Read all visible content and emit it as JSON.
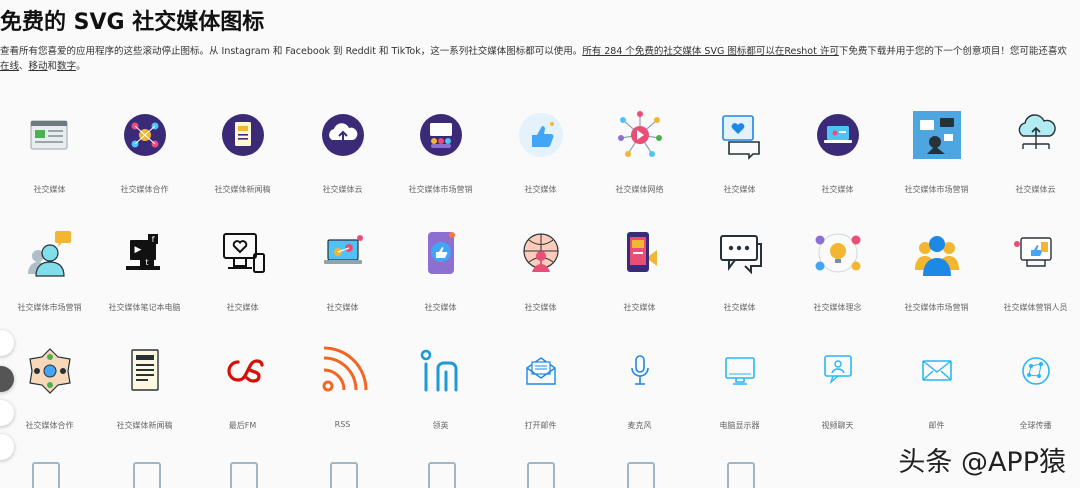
{
  "header": {
    "title": "免费的 SVG 社交媒体图标",
    "desc_part1": "查看所有您喜爱的应用程序的这些滚动停止图标。从 Instagram 和 Facebook 到 Reddit 和 TikTok，这一系列社交媒体图标都可以使用。",
    "desc_link1": "所有 284 个免费的社交媒体 SVG 图标都可以在Reshot 许可",
    "desc_part2": "下免费下载并用于您的下一个创意项目！您可能还喜欢",
    "desc_link2": "在线",
    "desc_sep1": "、",
    "desc_link3": "移动",
    "desc_sep2": "和",
    "desc_link4": "数字",
    "desc_end": "。"
  },
  "rows": [
    [
      {
        "label": "社交媒体",
        "icon": "browser-window-icon"
      },
      {
        "label": "社交媒体合作",
        "icon": "network-circle-icon"
      },
      {
        "label": "社交媒体新闻稿",
        "icon": "news-document-icon"
      },
      {
        "label": "社交媒体云",
        "icon": "cloud-upload-icon"
      },
      {
        "label": "社交媒体市场营销",
        "icon": "team-board-icon"
      },
      {
        "label": "社交媒体",
        "icon": "thumbs-up-icon"
      },
      {
        "label": "社交媒体网络",
        "icon": "play-network-icon"
      },
      {
        "label": "社交媒体",
        "icon": "heart-chat-icon"
      },
      {
        "label": "社交媒体",
        "icon": "laptop-circle-icon"
      },
      {
        "label": "社交媒体市场营销",
        "icon": "marketing-illustration-icon"
      },
      {
        "label": "社交媒体云",
        "icon": "cloud-network-icon"
      }
    ],
    [
      {
        "label": "社交媒体市场营销",
        "icon": "person-chat-icon"
      },
      {
        "label": "社交媒体笔记本电脑",
        "icon": "laptop-social-icon"
      },
      {
        "label": "社交媒体",
        "icon": "computer-heart-icon"
      },
      {
        "label": "社交媒体",
        "icon": "laptop-people-icon"
      },
      {
        "label": "社交媒体",
        "icon": "phone-like-icon"
      },
      {
        "label": "社交媒体",
        "icon": "globe-person-icon"
      },
      {
        "label": "社交媒体",
        "icon": "phone-media-icon"
      },
      {
        "label": "社交媒体",
        "icon": "chat-bubbles-icon"
      },
      {
        "label": "社交媒体理念",
        "icon": "lightbulb-idea-icon"
      },
      {
        "label": "社交媒体市场营销",
        "icon": "people-group-icon"
      },
      {
        "label": "社交媒体营销人员",
        "icon": "marketer-like-icon"
      }
    ],
    [
      {
        "label": "社交媒体合作",
        "icon": "hub-network-icon"
      },
      {
        "label": "社交媒体新闻稿",
        "icon": "newspaper-icon"
      },
      {
        "label": "最后FM",
        "icon": "lastfm-icon"
      },
      {
        "label": "RSS",
        "icon": "rss-icon"
      },
      {
        "label": "领英",
        "icon": "linkedin-icon"
      },
      {
        "label": "打开邮件",
        "icon": "open-mail-icon"
      },
      {
        "label": "麦克风",
        "icon": "microphone-icon"
      },
      {
        "label": "电脑显示器",
        "icon": "monitor-icon"
      },
      {
        "label": "视频聊天",
        "icon": "video-chat-icon"
      },
      {
        "label": "邮件",
        "icon": "mail-icon"
      },
      {
        "label": "全球传播",
        "icon": "global-network-icon"
      }
    ]
  ],
  "watermark": "头条 @APP猿"
}
